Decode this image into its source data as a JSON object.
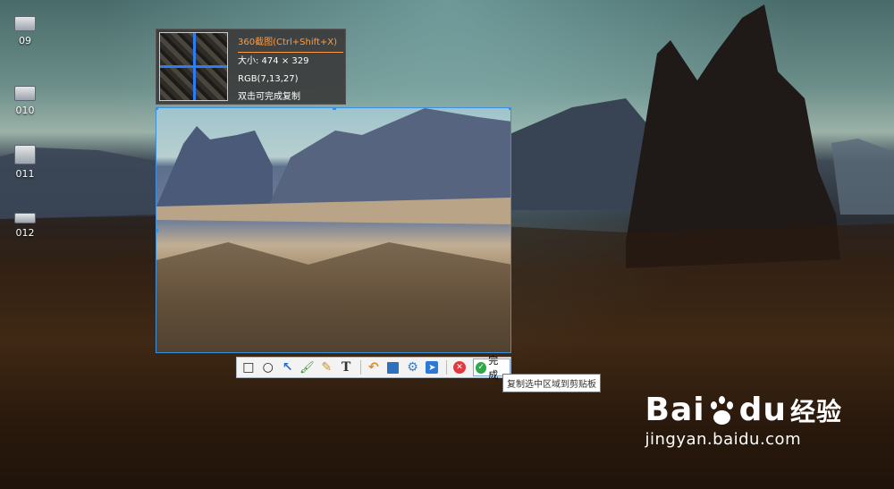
{
  "desktop": {
    "icons": [
      {
        "label": "09"
      },
      {
        "label": "010"
      },
      {
        "label": "011"
      },
      {
        "label": "012"
      }
    ]
  },
  "magnifier": {
    "title": "360截图(Ctrl+Shift+X)",
    "size_text": "大小: 474 × 329",
    "rgb_text": "RGB(7,13,27)",
    "hint_text": "双击可完成复制",
    "accent_color": "#ff9a42",
    "crosshair_color": "#2b7df4"
  },
  "toolbar": {
    "tools": [
      {
        "icon": "rectangle-icon",
        "glyph": "□"
      },
      {
        "icon": "ellipse-icon",
        "glyph": "○"
      },
      {
        "icon": "arrow-icon",
        "glyph": "↖"
      },
      {
        "icon": "brush-icon",
        "glyph": "🖌"
      },
      {
        "icon": "pencil-icon",
        "glyph": "✎"
      },
      {
        "icon": "text-icon",
        "glyph": "T"
      }
    ],
    "actions": [
      {
        "icon": "undo-icon",
        "glyph": "↶"
      },
      {
        "icon": "save-icon",
        "glyph": "💾"
      },
      {
        "icon": "settings-icon",
        "glyph": "⚙"
      },
      {
        "icon": "send-icon",
        "glyph": "➤"
      }
    ],
    "cancel_glyph": "✕",
    "done_label": "完成",
    "done_tooltip": "复制选中区域到剪贴板"
  },
  "watermark": {
    "brand": "Bai",
    "brand_tail": "du",
    "brand_cn": "经验",
    "url": "jingyan.baidu.com"
  }
}
